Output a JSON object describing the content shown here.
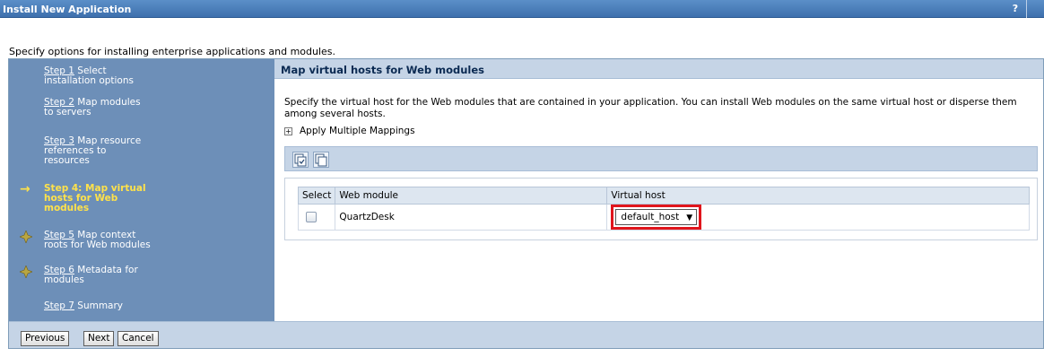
{
  "window": {
    "title": "Install New Application",
    "help_label": "?"
  },
  "intro": "Specify options for installing enterprise applications and modules.",
  "steps": [
    {
      "label": "Step 1",
      "text": " Select installation options",
      "line1": "Step 1 Select",
      "line2": "installation options"
    },
    {
      "line1": "Step 2 Map modules",
      "line2": "to servers"
    },
    {
      "line1": "Step 3 Map resource",
      "line2": "references to",
      "line3": "resources"
    },
    {
      "line1": "Step 4: Map virtual",
      "line2": "hosts for Web",
      "line3": "modules",
      "current": true
    },
    {
      "line1": "Step 5 Map context",
      "line2": "roots for Web modules"
    },
    {
      "line1": "Step 6 Metadata for",
      "line2": "modules"
    },
    {
      "line1": "Step 7 Summary"
    }
  ],
  "nav": {
    "s1_link": "Step 1",
    "s1_rest": " Select",
    "s1_l2": "installation options",
    "s2_link": "Step 2",
    "s2_rest": " Map modules",
    "s2_l2": "to servers",
    "s3_link": "Step 3",
    "s3_rest": " Map resource",
    "s3_l2": "references to",
    "s3_l3": "resources",
    "s4_l1": "Step 4: Map virtual",
    "s4_l2": "hosts for Web",
    "s4_l3": "modules",
    "s5_link": "Step 5",
    "s5_rest": " Map context",
    "s5_l2": "roots for Web modules",
    "s6_link": "Step 6",
    "s6_rest": " Metadata for",
    "s6_l2": "modules",
    "s7_link": "Step 7",
    "s7_rest": " Summary"
  },
  "main": {
    "header": "Map virtual hosts for Web modules",
    "description": "Specify the virtual host for the Web modules that are contained in your application. You can install Web modules on the same virtual host or disperse them among several hosts.",
    "apply_multiple": "Apply Multiple Mappings",
    "table": {
      "columns": [
        "Select",
        "Web module",
        "Virtual host"
      ],
      "rows": [
        {
          "web_module": "QuartzDesk",
          "virtual_host": "default_host"
        }
      ]
    }
  },
  "buttons": {
    "previous": "Previous",
    "next": "Next",
    "cancel": "Cancel"
  },
  "colors": {
    "nav_bg": "#6d8fb8",
    "current_step": "#ffe24a",
    "highlight": "#e0151c",
    "header_bg": "#c5d4e6"
  }
}
